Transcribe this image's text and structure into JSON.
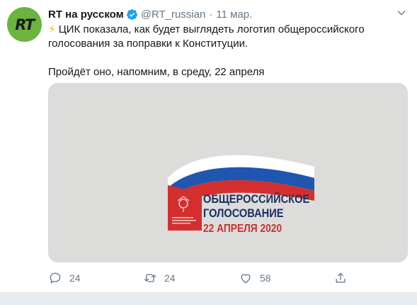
{
  "tweet": {
    "author_name": "RT на русском",
    "handle": "@RT_russian",
    "separator": "·",
    "date": "11 мар.",
    "avatar_text": "RT",
    "bolt": "⚡",
    "text_line1": " ЦИК показала, как будет выглядеть логотип общероссийского голосования за поправки к Конституции.",
    "text_line2": "Пройдёт оно, напомним, в среду, 22 апреля",
    "media": {
      "line1": "ОБЩЕРОССИЙСКОЕ",
      "line2": "ГОЛОСОВАНИЕ",
      "line3": "22 АПРЕЛЯ 2020"
    },
    "actions": {
      "reply_count": "24",
      "retweet_count": "24",
      "like_count": "58"
    }
  },
  "colors": {
    "avatar_bg": "#6cb33f",
    "verified": "#1da1f2",
    "media_bg": "#dcdcdb",
    "logo_red": "#d32f2f",
    "logo_blue": "#1c2f63"
  }
}
